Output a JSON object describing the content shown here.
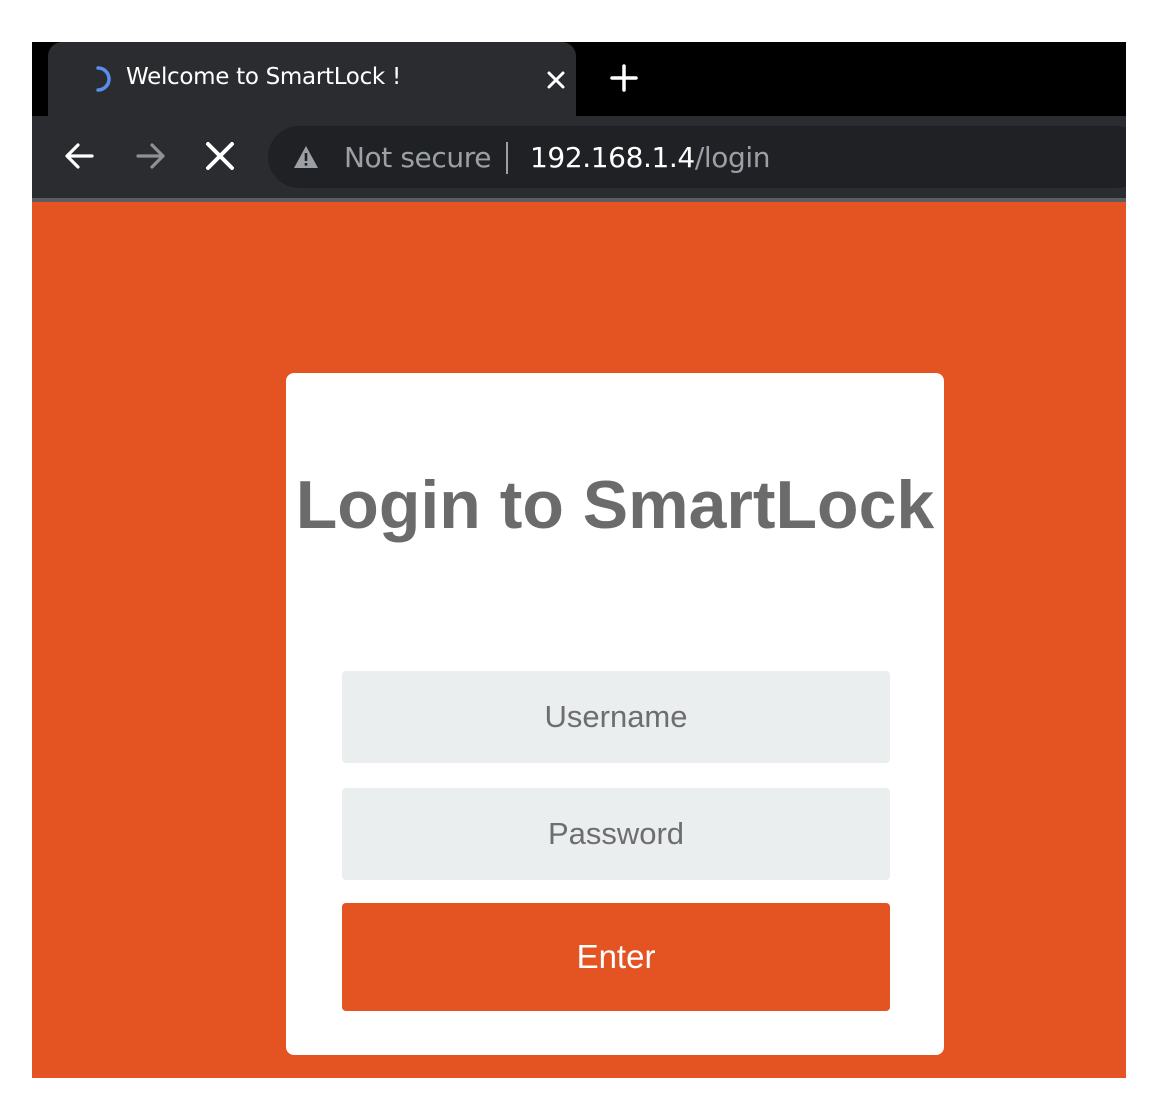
{
  "browser": {
    "tab": {
      "title": "Welcome to SmartLock !",
      "loading": true
    },
    "address_bar": {
      "security_label": "Not secure",
      "url_host": "192.168.1.4",
      "url_path": "/login"
    },
    "icons": {
      "tab_spinner": "loading-spinner-icon",
      "tab_close": "close-icon",
      "new_tab": "plus-icon",
      "back": "arrow-left-icon",
      "forward": "arrow-right-icon",
      "stop": "close-icon",
      "security": "warning-triangle-icon"
    }
  },
  "login": {
    "title": "Login to SmartLock",
    "username_placeholder": "Username",
    "password_placeholder": "Password",
    "submit_label": "Enter"
  },
  "colors": {
    "brand": "#e35422",
    "card": "#ffffff",
    "field_bg": "#ebeeef",
    "title_text": "#6b6b6b",
    "spinner": "#5b8def"
  }
}
